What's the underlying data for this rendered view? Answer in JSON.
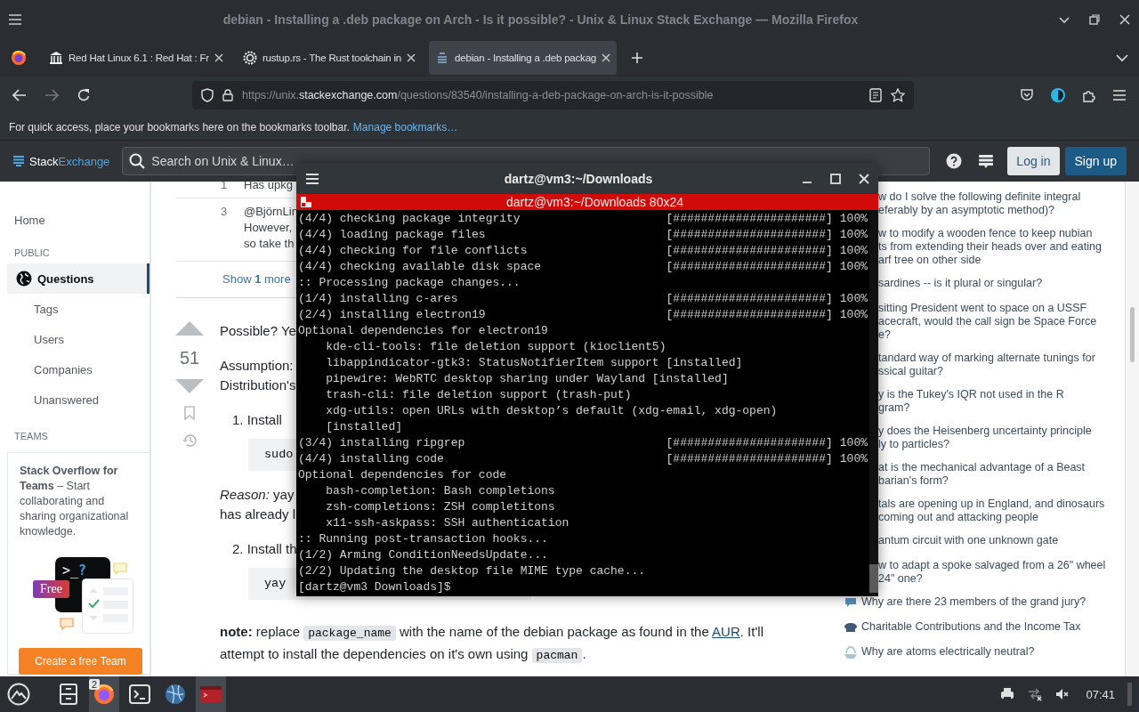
{
  "window": {
    "title": "debian - Installing a .deb package on Arch - Is it possible? - Unix & Linux Stack Exchange — Mozilla Firefox"
  },
  "tabs": [
    {
      "label": "Red Hat Linux 6.1 : Red Hat : Fr",
      "selected": false
    },
    {
      "label": "rustup.rs - The Rust toolchain in",
      "selected": false
    },
    {
      "label": "debian - Installing a .deb packag",
      "selected": true
    }
  ],
  "address_bar": {
    "prefix": "https://unix.",
    "domain": "stackexchange.com",
    "path": "/questions/83540/installing-a-deb-package-on-arch-is-it-possible"
  },
  "bookmarks_bar": {
    "message": "For quick access, place your bookmarks here on the bookmarks toolbar.",
    "link": "Manage bookmarks…"
  },
  "site_header": {
    "logo_first": "Stack",
    "logo_second": "Exchange",
    "search": {
      "placeholder": "Search on Unix & Linux…"
    },
    "login": "Log in",
    "signup": "Sign up"
  },
  "left_nav": [
    {
      "kind": "plain",
      "label": "Home",
      "selected": false
    },
    {
      "kind": "heading",
      "label": "PUBLIC"
    },
    {
      "kind": "main",
      "label": "Questions",
      "selected": true
    },
    {
      "kind": "sub",
      "label": "Tags",
      "selected": false
    },
    {
      "kind": "sub",
      "label": "Users",
      "selected": false
    },
    {
      "kind": "sub",
      "label": "Companies",
      "selected": false
    },
    {
      "kind": "sub",
      "label": "Unanswered",
      "selected": false
    },
    {
      "kind": "heading",
      "label": "TEAMS"
    }
  ],
  "teams_card": {
    "text": "**Stack Overflow for Teams** – Start collaborating and sharing organizational knowledge.",
    "prompt": ">_",
    "prompt_mark": "?",
    "badge": "Free",
    "button": "Create a free Team"
  },
  "comments": [
    {
      "number": "1",
      "lines": [
        "Has upkg"
      ]
    },
    {
      "number": "3",
      "lines": [
        "@BjörnLin",
        "However,",
        "so take th"
      ]
    }
  ],
  "show_more": "Show **1** more",
  "answer": {
    "score": "51",
    "blocks": [
      {
        "kind": "text",
        "lines": [
          "Possible? Ye"
        ]
      },
      {
        "kind": "text",
        "lines": [
          "Assumption:",
          "Distribution's"
        ]
      },
      {
        "kind": "step",
        "text": "1. Install"
      },
      {
        "kind": "code",
        "text": "sudo"
      },
      {
        "kind": "text",
        "lines": [
          "*Reason:* yay",
          "has already l"
        ]
      },
      {
        "kind": "step",
        "text": "2. Install th"
      },
      {
        "kind": "code",
        "text": "yay"
      },
      {
        "kind": "note",
        "parts": [
          {
            "kind": "bold",
            "text": "note:"
          },
          {
            "kind": "text",
            "text": " replace "
          },
          {
            "kind": "code",
            "text": "package_name"
          },
          {
            "kind": "text",
            "text": " with the name of the debian package as found in the "
          },
          {
            "kind": "link",
            "text": "AUR"
          },
          {
            "kind": "text",
            "text": ". It'll attempt to install the dependencies on it's own using "
          },
          {
            "kind": "code",
            "text": "pacman"
          },
          {
            "kind": "text",
            "text": "."
          }
        ]
      }
    ]
  },
  "hot_network": [
    {
      "kind": "partial",
      "lines": [
        "w do I solve the following definite integral",
        "eferably by an asymptotic method)?"
      ]
    },
    {
      "kind": "partial",
      "lines": [
        "w to modify a wooden fence to keep nubian",
        "ts from extending their heads over and eating",
        "arf tree on other side"
      ]
    },
    {
      "kind": "partial",
      "lines": [
        "sardines -- is it plural or singular?"
      ]
    },
    {
      "kind": "partial",
      "lines": [
        "sitting President went to space on a USSF",
        "acecraft, would the call sign be Space Force",
        "e?"
      ]
    },
    {
      "kind": "partial",
      "lines": [
        "tandard way of marking alternate tunings for",
        "ssical guitar?"
      ]
    },
    {
      "kind": "partial",
      "lines": [
        "y is the Tukey's IQR not used in the R",
        "gram?"
      ]
    },
    {
      "kind": "partial",
      "lines": [
        "y does the Heisenberg uncertainty principle",
        "ly to particles?"
      ]
    },
    {
      "kind": "partial",
      "lines": [
        "at is the mechanical advantage of a Beast",
        "barian's form?"
      ]
    },
    {
      "kind": "partial",
      "lines": [
        "tals are opening up in England, and dinosaurs",
        "coming out and attacking people"
      ]
    },
    {
      "kind": "partial",
      "lines": [
        "antum circuit with one unknown gate"
      ]
    },
    {
      "kind": "partial",
      "lines": [
        "w to adapt a spoke salvaged from a 26\" wheel",
        "24\" one?"
      ]
    },
    {
      "kind": "full",
      "lines": [
        "Why are there 23 members of the grand jury?"
      ]
    },
    {
      "kind": "full",
      "lines": [
        "Charitable Contributions and the Income Tax"
      ]
    },
    {
      "kind": "full",
      "lines": [
        "Why are atoms electrically neutral?"
      ]
    }
  ],
  "terminal": {
    "title": "dartz@vm3:~/Downloads",
    "header": "dartz@vm3:~/Downloads 80x24",
    "lines": [
      {
        "text": "(4/4) checking package integrity",
        "bar": "[######################]",
        "percent": "100%"
      },
      {
        "text": "(4/4) loading package files",
        "bar": "[######################]",
        "percent": "100%"
      },
      {
        "text": "(4/4) checking for file conflicts",
        "bar": "[######################]",
        "percent": "100%"
      },
      {
        "text": "(4/4) checking available disk space",
        "bar": "[######################]",
        "percent": "100%"
      },
      {
        "text": ":: Processing package changes..."
      },
      {
        "text": "(1/4) installing c-ares",
        "bar": "[######################]",
        "percent": "100%"
      },
      {
        "text": "(2/4) installing electron19",
        "bar": "[######################]",
        "percent": "100%"
      },
      {
        "text": "Optional dependencies for electron19"
      },
      {
        "text": "    kde-cli-tools: file deletion support (kioclient5)"
      },
      {
        "text": "    libappindicator-gtk3: StatusNotifierItem support [installed]"
      },
      {
        "text": "    pipewire: WebRTC desktop sharing under Wayland [installed]"
      },
      {
        "text": "    trash-cli: file deletion support (trash-put)"
      },
      {
        "text": "    xdg-utils: open URLs with desktop’s default (xdg-email, xdg-open)"
      },
      {
        "text": "    [installed]"
      },
      {
        "text": "(3/4) installing ripgrep",
        "bar": "[######################]",
        "percent": "100%"
      },
      {
        "text": "(4/4) installing code",
        "bar": "[######################]",
        "percent": "100%"
      },
      {
        "text": "Optional dependencies for code"
      },
      {
        "text": "    bash-completion: Bash completions"
      },
      {
        "text": "    zsh-completions: ZSH completitons"
      },
      {
        "text": "    x11-ssh-askpass: SSH authentication"
      },
      {
        "text": ":: Running post-transaction hooks..."
      },
      {
        "text": "(1/2) Arming ConditionNeedsUpdate..."
      },
      {
        "text": "(2/2) Updating the desktop file MIME type cache..."
      },
      {
        "text": "[dartz@vm3 Downloads]$"
      }
    ]
  },
  "taskbar": {
    "apps": [
      {
        "kind": "launcher",
        "active": false
      },
      {
        "kind": "files",
        "active": false
      },
      {
        "kind": "browser",
        "active": true,
        "badge": "2"
      },
      {
        "kind": "terminal",
        "active": false
      },
      {
        "kind": "network",
        "active": false
      },
      {
        "kind": "console",
        "active": true
      }
    ],
    "clock": "07:41"
  }
}
